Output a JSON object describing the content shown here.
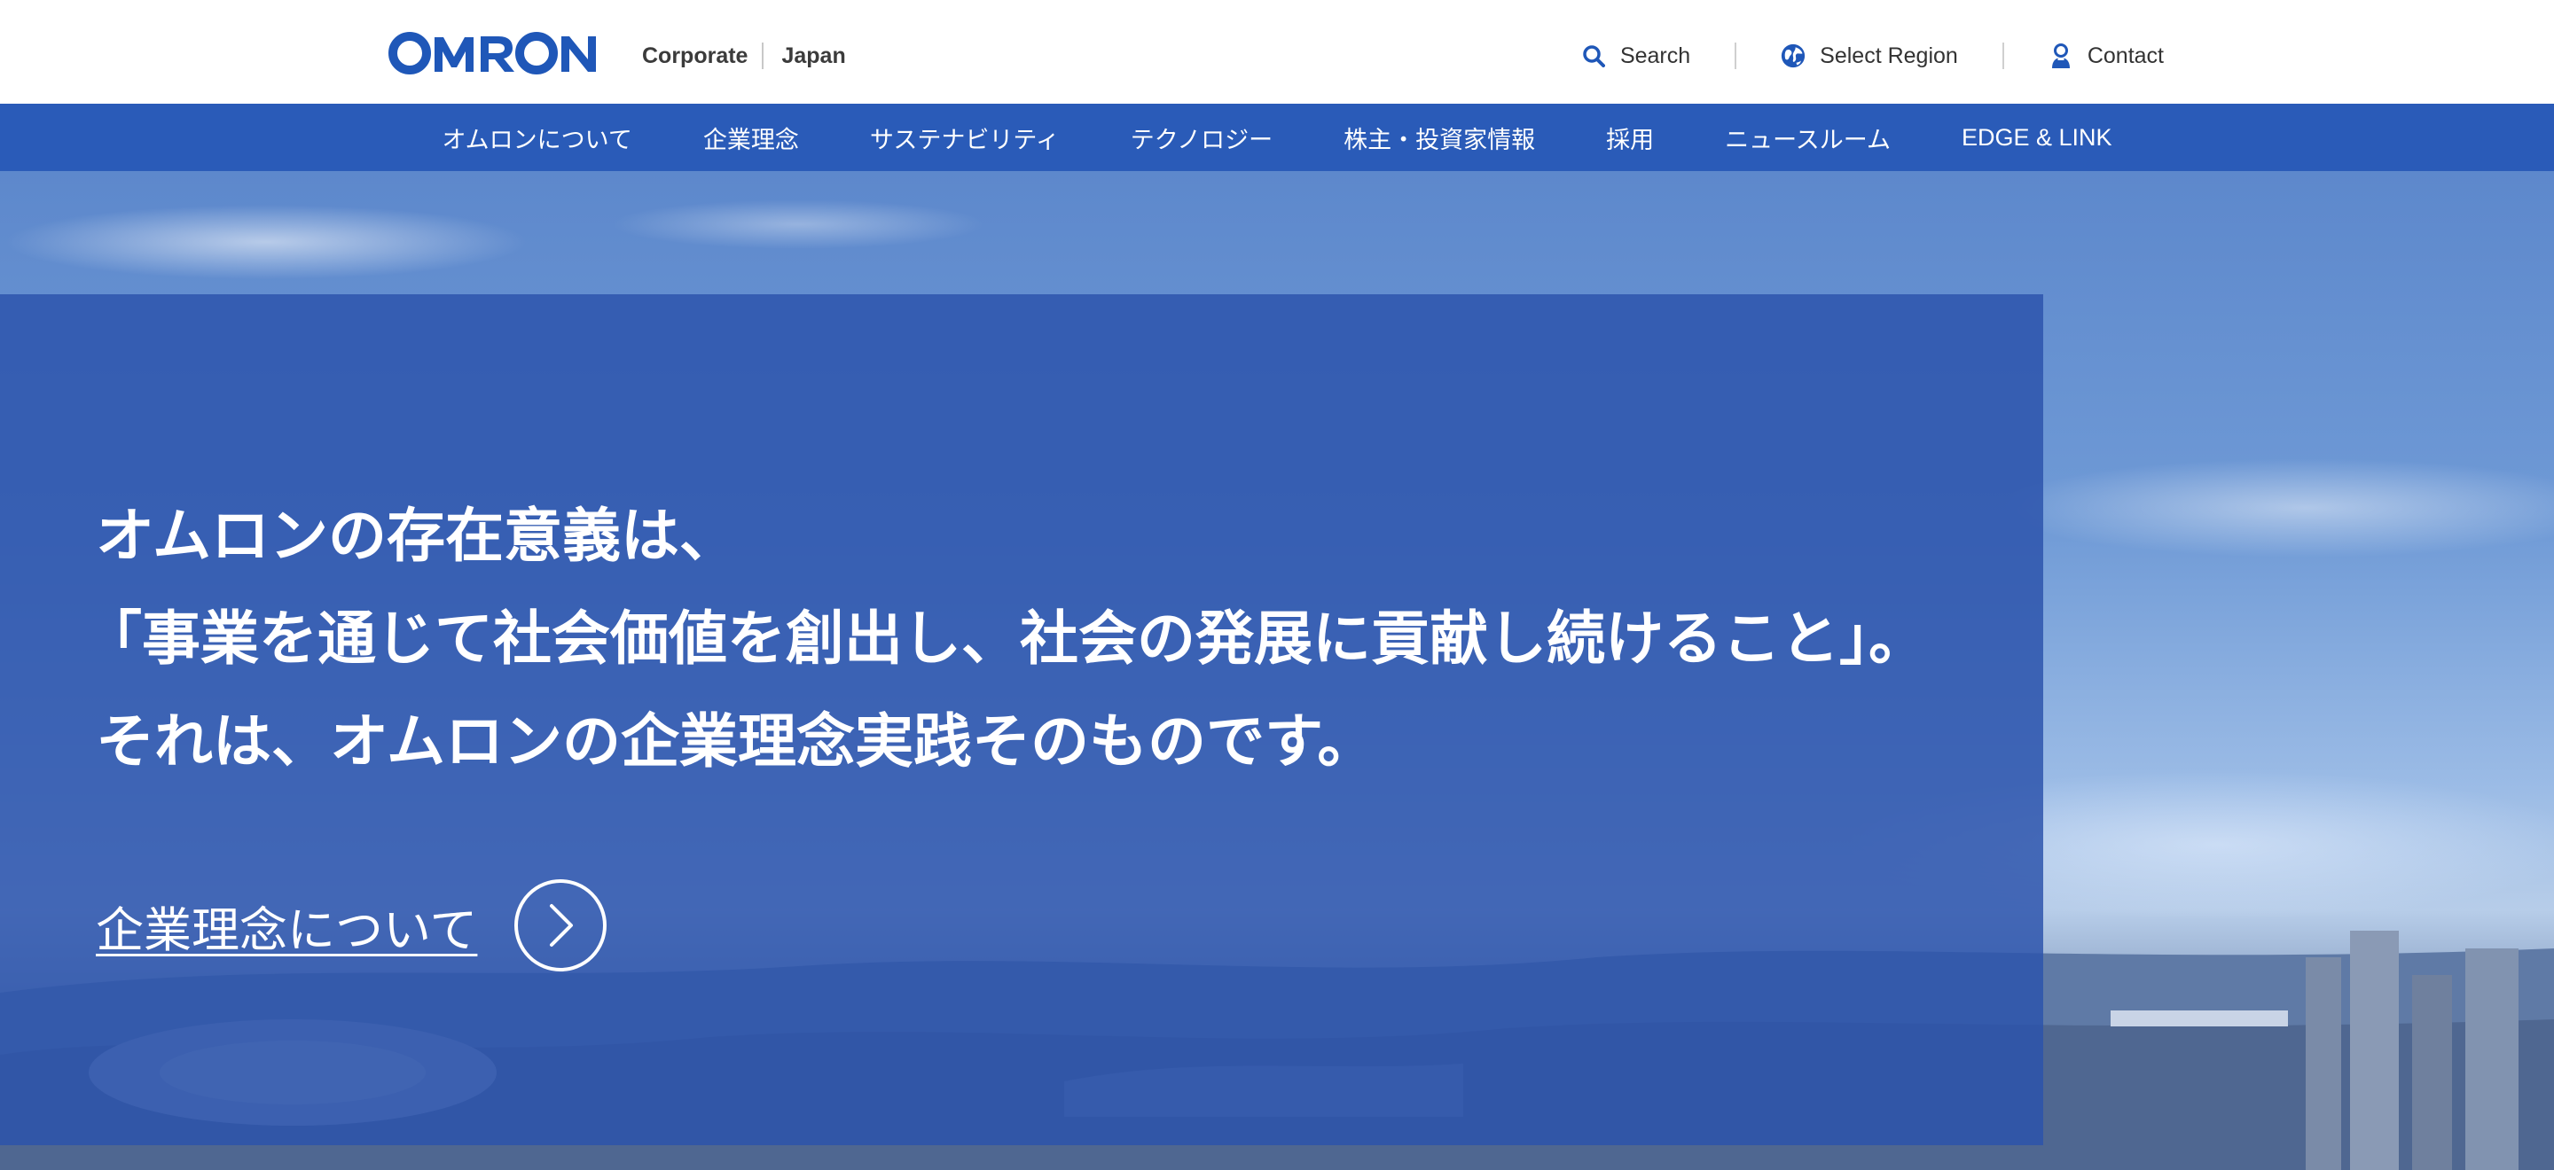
{
  "header": {
    "logo_text": "OMRON",
    "site_primary": "Corporate",
    "site_secondary": "Japan",
    "utility": {
      "search_label": "Search",
      "region_label": "Select Region",
      "contact_label": "Contact"
    }
  },
  "nav": {
    "items": [
      "オムロンについて",
      "企業理念",
      "サステナビリティ",
      "テクノロジー",
      "株主・投資家情報",
      "採用",
      "ニュースルーム",
      "EDGE & LINK"
    ]
  },
  "hero": {
    "line1": "オムロンの存在意義は、",
    "line2": "「事業を通じて社会価値を創出し、社会の発展に貢献し続けること」。",
    "line3": "それは、オムロンの企業理念実践そのものです。",
    "link_label": "企業理念について"
  },
  "colors": {
    "brand_blue": "#2a5bb8",
    "logo_blue": "#1f57b8",
    "panel_blue": "#2c54ac"
  },
  "icons": {
    "search": "search-icon",
    "region": "globe-icon",
    "contact": "person-icon",
    "arrow": "chevron-right-icon"
  }
}
